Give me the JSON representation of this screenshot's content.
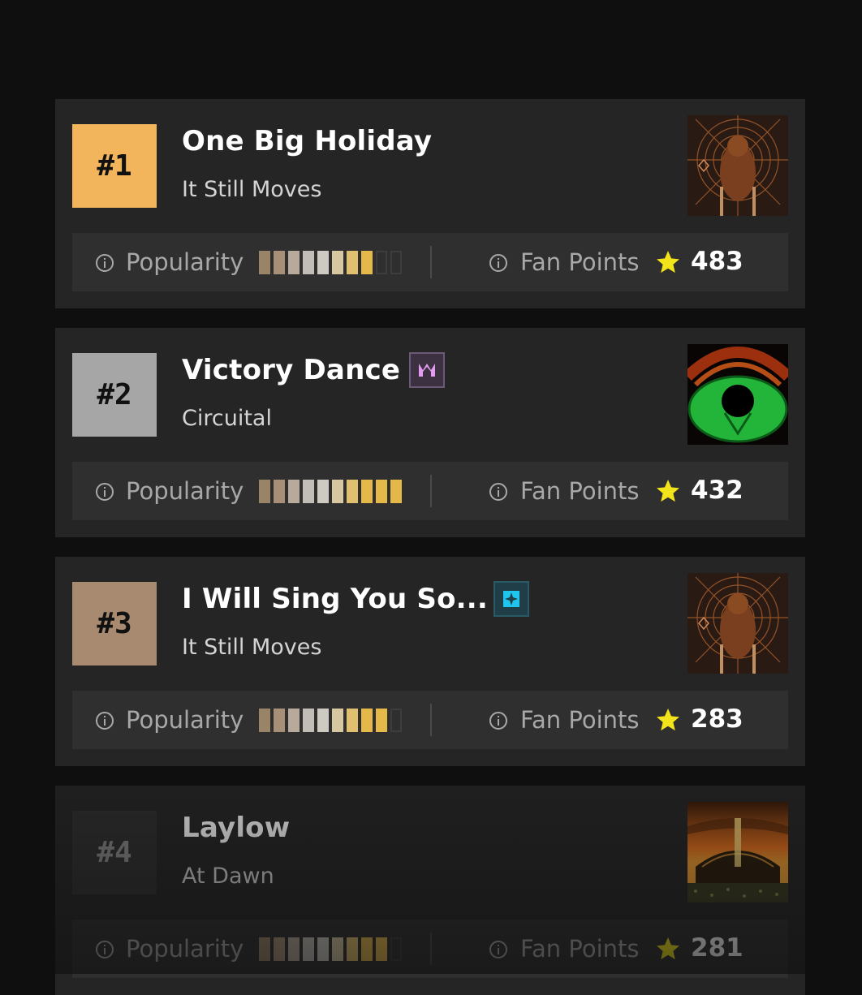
{
  "labels": {
    "popularity": "Popularity",
    "fan_points": "Fan Points"
  },
  "colors": {
    "rank1": "#f2b55b",
    "rank2": "#a6a6a6",
    "rank3": "#a88a70",
    "rank4": "#2f2f2f",
    "star": "#f2e31a",
    "bar_palette": [
      "#9a8468",
      "#a89078",
      "#b8aa9a",
      "#c2bdb6",
      "#cfcac1",
      "#d8c8a2",
      "#e0c06e",
      "#e5b84a",
      "#e5b84a",
      "#e5b84a"
    ]
  },
  "tracks": [
    {
      "rank": "#1",
      "title": "One Big Holiday",
      "album": "It Still Moves",
      "cover_icon": "album-cover-bear",
      "badge_icon": "",
      "popularity": 8,
      "popularity_max": 10,
      "fan_points": "483"
    },
    {
      "rank": "#2",
      "title": "Victory Dance",
      "album": "Circuital",
      "cover_icon": "album-cover-green-eye",
      "badge_icon": "crown-icon",
      "popularity": 10,
      "popularity_max": 10,
      "fan_points": "432"
    },
    {
      "rank": "#3",
      "title": "I Will Sing You So...",
      "album": "It Still Moves",
      "cover_icon": "album-cover-bear",
      "badge_icon": "sparkle-icon",
      "popularity": 9,
      "popularity_max": 10,
      "fan_points": "283"
    },
    {
      "rank": "#4",
      "title": "Laylow",
      "album": "At Dawn",
      "cover_icon": "album-cover-sunset",
      "badge_icon": "",
      "popularity": 9,
      "popularity_max": 10,
      "fan_points": "281"
    }
  ]
}
